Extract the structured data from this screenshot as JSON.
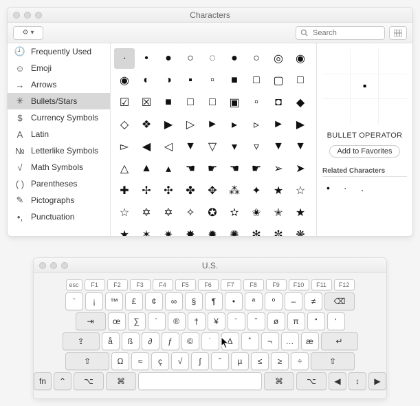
{
  "chars_window": {
    "title": "Characters",
    "search_placeholder": "Search"
  },
  "sidebar": {
    "items": [
      {
        "icon": "🕘",
        "label": "Frequently Used"
      },
      {
        "icon": "☺",
        "label": "Emoji"
      },
      {
        "icon": "→",
        "label": "Arrows"
      },
      {
        "icon": "✳",
        "label": "Bullets/Stars"
      },
      {
        "icon": "$",
        "label": "Currency Symbols"
      },
      {
        "icon": "A",
        "label": "Latin"
      },
      {
        "icon": "№",
        "label": "Letterlike Symbols"
      },
      {
        "icon": "√",
        "label": "Math Symbols"
      },
      {
        "icon": "( )",
        "label": "Parentheses"
      },
      {
        "icon": "✎",
        "label": "Pictographs"
      },
      {
        "icon": "•,",
        "label": "Punctuation"
      }
    ],
    "selected_index": 3
  },
  "grid": {
    "selected": [
      0,
      0
    ],
    "rows": [
      [
        "·",
        "•",
        "●",
        "○",
        "◌",
        "●",
        "○",
        "◎",
        "◉"
      ],
      [
        "◉",
        "◐",
        "◑",
        "▪",
        "▫",
        "■",
        "□",
        "▢",
        "□"
      ],
      [
        "☑",
        "☒",
        "■",
        "□",
        "□",
        "▣",
        "▫",
        "◘",
        "◆"
      ],
      [
        "◇",
        "❖",
        "▶",
        "▷",
        "►",
        "▸",
        "▹",
        "►",
        "▶"
      ],
      [
        "▻",
        "◀",
        "◁",
        "▼",
        "▽",
        "▾",
        "▿",
        "▼",
        "▼"
      ],
      [
        "△",
        "▲",
        "▴",
        "☚",
        "☛",
        "☚",
        "☛",
        "➢",
        "➤"
      ],
      [
        "✚",
        "✢",
        "✣",
        "✤",
        "✥",
        "⁂",
        "✦",
        "★",
        "☆"
      ],
      [
        "☆",
        "✡",
        "✡",
        "✧",
        "✪",
        "✫",
        "✬",
        "✭",
        "★"
      ],
      [
        "★",
        "✶",
        "✷",
        "✸",
        "✹",
        "✺",
        "✻",
        "✼",
        "❋"
      ]
    ]
  },
  "detail": {
    "preview_glyph": "▪",
    "char_name": "BULLET OPERATOR",
    "favorite_label": "Add to Favorites",
    "related_header": "Related Characters",
    "related": [
      "•",
      "·",
      "․"
    ]
  },
  "keyboard": {
    "title": "U.S.",
    "fn_row": [
      "esc",
      "F1",
      "F2",
      "F3",
      "F4",
      "F5",
      "F6",
      "F7",
      "F8",
      "F9",
      "F10",
      "F11",
      "F12"
    ],
    "row1": [
      "`",
      "¡",
      "™",
      "£",
      "¢",
      "∞",
      "§",
      "¶",
      "•",
      "ª",
      "º",
      "–",
      "≠",
      "⌫"
    ],
    "row2": [
      "⇥",
      "œ",
      "∑",
      "´",
      "®",
      "†",
      "¥",
      "¨",
      "ˆ",
      "ø",
      "π",
      "“",
      "‘"
    ],
    "row3": [
      "⇪",
      "å",
      "ß",
      "∂",
      "ƒ",
      "©",
      "˙",
      "∆",
      "˚",
      "¬",
      "…",
      "æ",
      "↵"
    ],
    "row4": [
      "⇧",
      "Ω",
      "≈",
      "ç",
      "√",
      "∫",
      "˜",
      "µ",
      "≤",
      "≥",
      "÷",
      "⇧"
    ],
    "row5": [
      "fn",
      "⌃",
      "⌥",
      "⌘",
      "",
      "⌘",
      "⌥",
      "◀",
      "↕",
      "▶"
    ]
  }
}
